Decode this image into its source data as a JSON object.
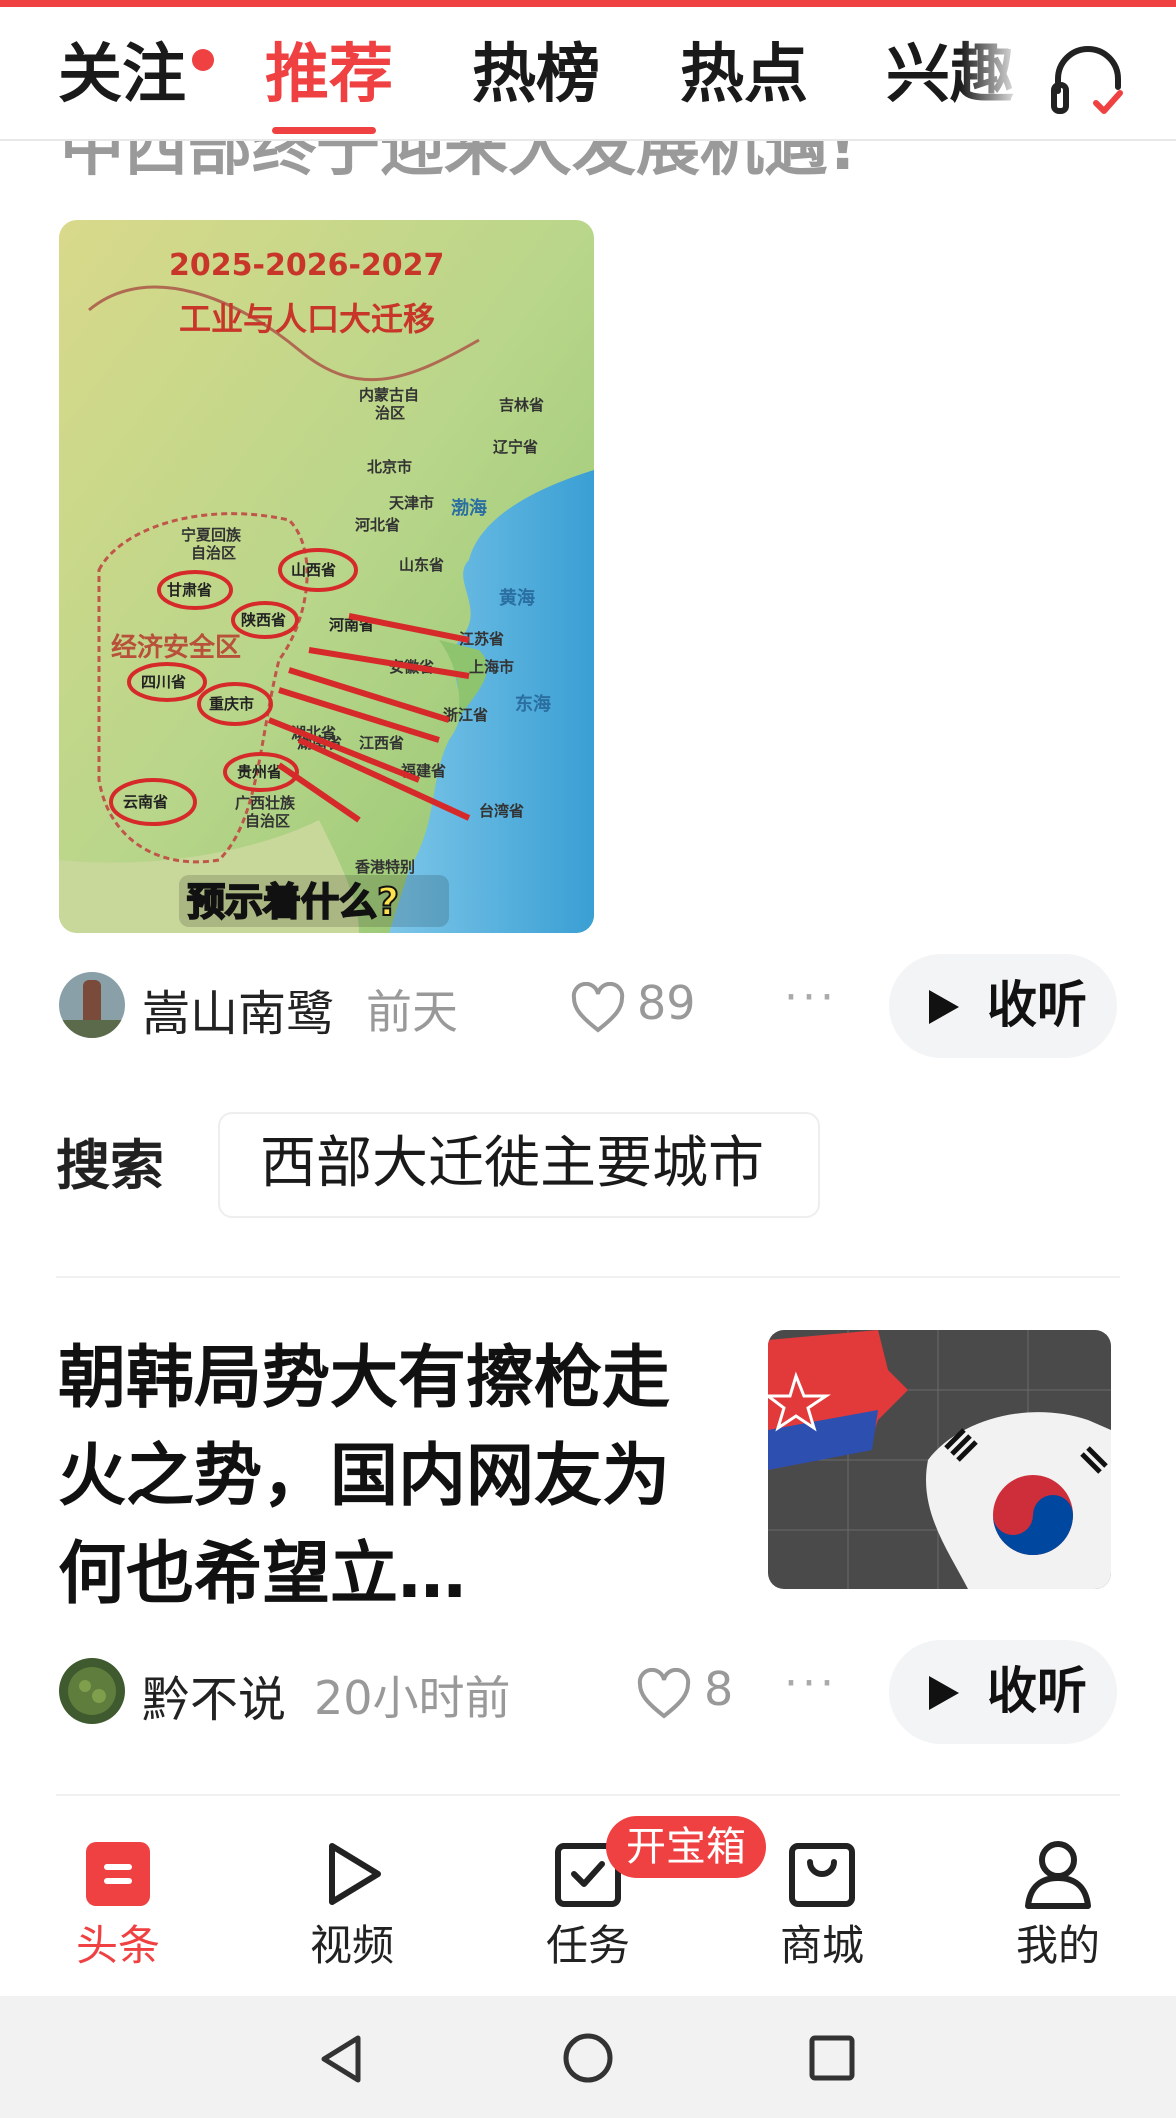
{
  "top_tabs": {
    "follow": "关注",
    "recommend": "推荐",
    "hot_list": "热榜",
    "hot_spot": "热点",
    "interest": "兴趣"
  },
  "article1": {
    "title_partial": "中西部终于迎来大发展机遇!",
    "image_text": {
      "years": "2025-2026-2027",
      "headline": "工业与人口大迁移",
      "zone": "经济安全区",
      "caption": "预示着什么?",
      "places": [
        "内蒙古自治区",
        "北京市",
        "天津市",
        "河北省",
        "辽宁省",
        "吉林省",
        "宁夏回族自治区",
        "山西省",
        "甘肃省",
        "陕西省",
        "河南省",
        "山东省",
        "江苏省",
        "上海市",
        "安徽省",
        "四川省",
        "重庆市",
        "湖北省",
        "浙江省",
        "湖南省",
        "江西省",
        "贵州省",
        "福建省",
        "云南省",
        "广西壮族自治区",
        "台湾省",
        "渤海",
        "黄海",
        "东海",
        "香港特别"
      ]
    },
    "author": "嵩山南鹭",
    "time": "前天",
    "likes": "89",
    "listen_label": "收听"
  },
  "search": {
    "label": "搜索",
    "suggestion": "西部大迁徙主要城市"
  },
  "article2": {
    "title": "朝韩局势大有擦枪走火之势，国内网友为何也希望立…",
    "author": "黔不说",
    "time": "20小时前",
    "likes": "8",
    "listen_label": "收听"
  },
  "bottom_nav": {
    "items": [
      {
        "label": "头条",
        "icon": "headlines-icon"
      },
      {
        "label": "视频",
        "icon": "video-play-icon"
      },
      {
        "label": "任务",
        "icon": "task-check-icon"
      },
      {
        "label": "商城",
        "icon": "shopping-bag-icon"
      },
      {
        "label": "我的",
        "icon": "person-icon"
      }
    ],
    "task_badge": "开宝箱"
  },
  "colors": {
    "accent": "#f04142",
    "muted": "#999999"
  }
}
